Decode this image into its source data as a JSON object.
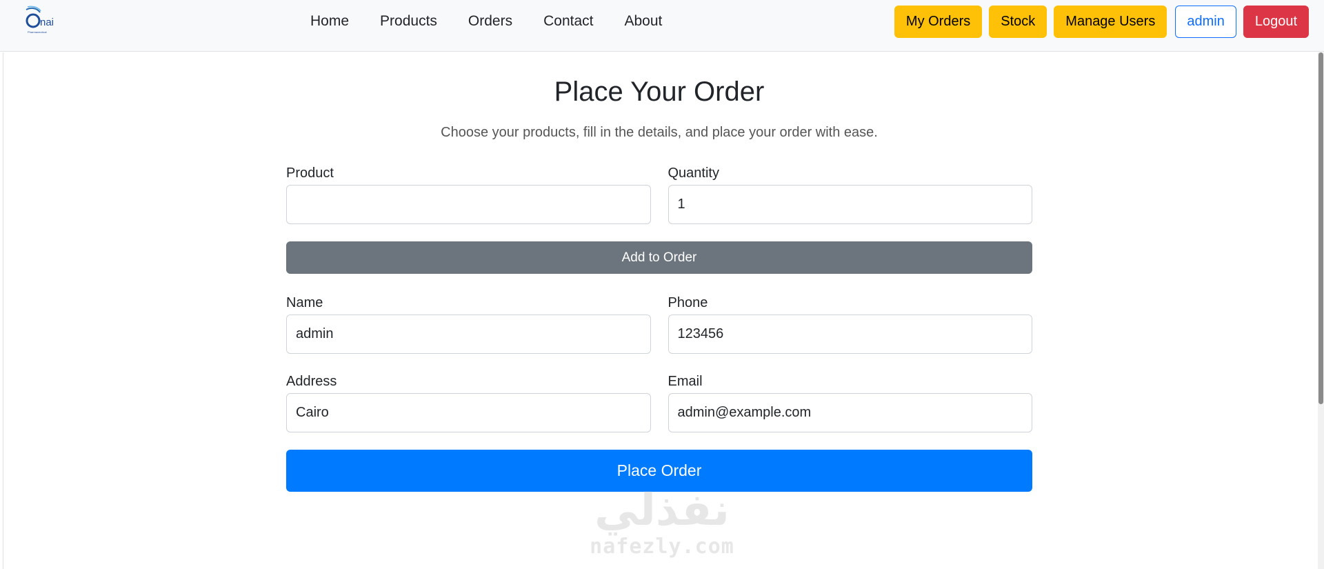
{
  "nav": {
    "brand_text": "nai",
    "brand_subtext": "Pharmaceutical",
    "links": [
      "Home",
      "Products",
      "Orders",
      "Contact",
      "About"
    ],
    "my_orders": "My Orders",
    "stock": "Stock",
    "manage_users": "Manage Users",
    "user": "admin",
    "logout": "Logout"
  },
  "page": {
    "title": "Place Your Order",
    "subtitle": "Choose your products, fill in the details, and place your order with ease."
  },
  "form": {
    "product_label": "Product",
    "product_value": "",
    "quantity_label": "Quantity",
    "quantity_value": "1",
    "add_button": "Add to Order",
    "name_label": "Name",
    "name_value": "admin",
    "phone_label": "Phone",
    "phone_value": "123456",
    "address_label": "Address",
    "address_value": "Cairo",
    "email_label": "Email",
    "email_value": "admin@example.com",
    "place_button": "Place Order"
  },
  "watermark": {
    "arabic": "نفذلي",
    "latin": "nafezly.com"
  },
  "colors": {
    "warning": "#ffc107",
    "primary": "#007bff",
    "secondary": "#6c757d",
    "danger": "#dc3545",
    "outline_primary": "#0d6efd"
  }
}
